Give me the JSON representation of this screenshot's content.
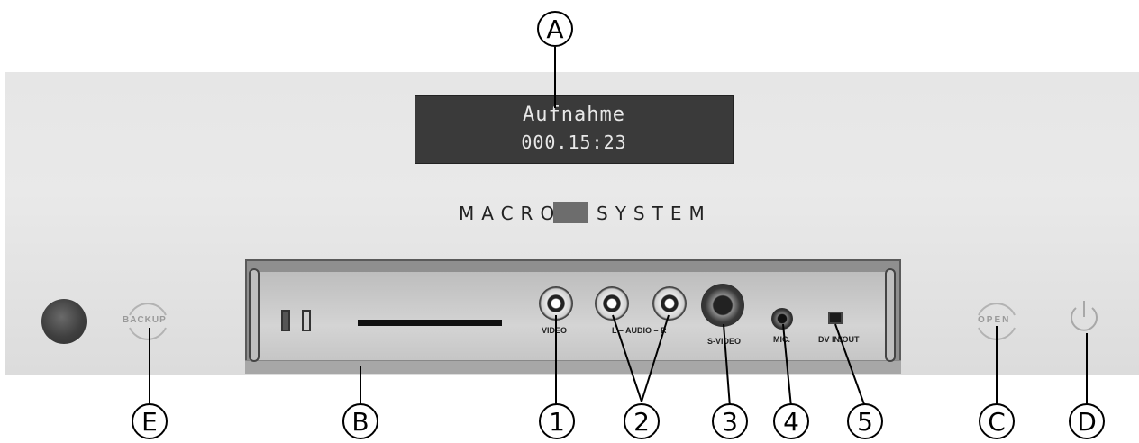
{
  "display": {
    "line1": "Aufnahme",
    "line2": "000.15:23"
  },
  "logo": {
    "left": "MACRO",
    "right": "SYSTEM"
  },
  "buttons": {
    "backup": "BACKUP",
    "open": "OPEN"
  },
  "ports": {
    "video": "VIDEO",
    "audio": "L – AUDIO – R",
    "svideo": "S-VIDEO",
    "mic": "MIC.",
    "dv": "DV IN/OUT"
  },
  "callouts": {
    "a": "A",
    "b": "B",
    "c": "C",
    "d": "D",
    "e": "E",
    "n1": "1",
    "n2": "2",
    "n3": "3",
    "n4": "4",
    "n5": "5"
  },
  "colors": {
    "display_bg": "#3a3a3a",
    "display_text": "#e8e8e8",
    "logo_box": "#6d6d6d"
  },
  "icons": [
    "power-icon",
    "speaker-grille-icon",
    "rca-jack-icon",
    "svideo-jack-icon",
    "firewire-icon"
  ]
}
